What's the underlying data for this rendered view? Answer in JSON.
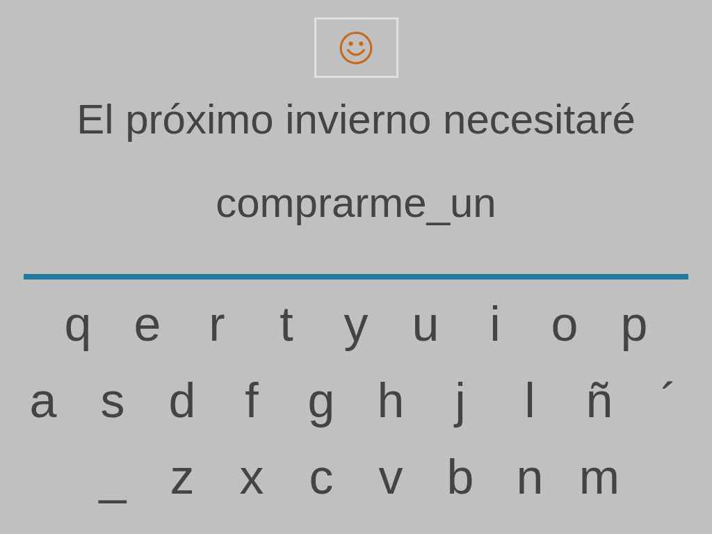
{
  "prompt_lines": [
    "El próximo invierno necesitaré",
    "comprarme_un"
  ],
  "keyboard_rows": [
    [
      "q",
      "e",
      "r",
      "t",
      "y",
      "u",
      "i",
      "o",
      "p"
    ],
    [
      "a",
      "s",
      "d",
      "f",
      "g",
      "h",
      "j",
      "l",
      "ñ",
      "´"
    ],
    [
      "_",
      "z",
      "x",
      "c",
      "v",
      "b",
      "n",
      "m"
    ]
  ]
}
